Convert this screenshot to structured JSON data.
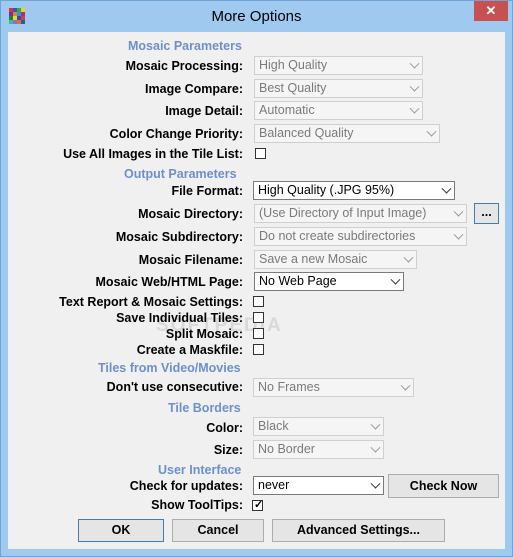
{
  "window": {
    "title": "More Options",
    "close_glyph": "✕"
  },
  "mosaic_parameters": {
    "heading": "Mosaic Parameters",
    "processing": {
      "label": "Mosaic Processing:",
      "value": "High Quality"
    },
    "compare": {
      "label": "Image Compare:",
      "value": "Best Quality"
    },
    "detail": {
      "label": "Image Detail:",
      "value": "Automatic"
    },
    "color_priority": {
      "label": "Color Change Priority:",
      "value": "Balanced Quality"
    },
    "use_all": {
      "label": "Use All Images in the Tile List:",
      "checked": false
    }
  },
  "output_parameters": {
    "heading": "Output Parameters",
    "file_format": {
      "label": "File Format:",
      "value": "High Quality (.JPG  95%)"
    },
    "directory": {
      "label": "Mosaic Directory:",
      "value": "(Use Directory of Input Image)",
      "browse": "..."
    },
    "subdirectory": {
      "label": "Mosaic Subdirectory:",
      "value": "Do not create subdirectories"
    },
    "filename": {
      "label": "Mosaic Filename:",
      "value": "Save a new Mosaic"
    },
    "web_page": {
      "label": "Mosaic Web/HTML Page:",
      "value": "No Web Page"
    },
    "text_report": {
      "label": "Text Report & Mosaic Settings:",
      "checked": false
    },
    "save_tiles": {
      "label": "Save Individual Tiles:",
      "checked": false
    },
    "split": {
      "label": "Split Mosaic:",
      "checked": false
    },
    "maskfile": {
      "label": "Create a Maskfile:",
      "checked": false
    }
  },
  "tiles_video": {
    "heading": "Tiles from Video/Movies",
    "consecutive": {
      "label": "Don't use consecutive:",
      "value": "No Frames"
    }
  },
  "tile_borders": {
    "heading": "Tile Borders",
    "color": {
      "label": "Color:",
      "value": "Black"
    },
    "size": {
      "label": "Size:",
      "value": "No Border"
    }
  },
  "user_interface": {
    "heading": "User Interface",
    "updates": {
      "label": "Check for updates:",
      "value": "never",
      "button": "Check Now"
    },
    "tooltips": {
      "label": "Show ToolTips:",
      "checked": true
    }
  },
  "buttons": {
    "ok": "OK",
    "cancel": "Cancel",
    "advanced": "Advanced Settings..."
  },
  "watermark": "SOFTPEDIA",
  "icon_colors": [
    "#e53030",
    "#3050e0",
    "#30b030",
    "#f0d020",
    "#7030a0",
    "#f08020",
    "#20a0d0",
    "#c02080",
    "#208040",
    "#e0e020",
    "#4040c0",
    "#d04040",
    "#30c0a0",
    "#a060e0",
    "#e07020",
    "#2060a0"
  ]
}
